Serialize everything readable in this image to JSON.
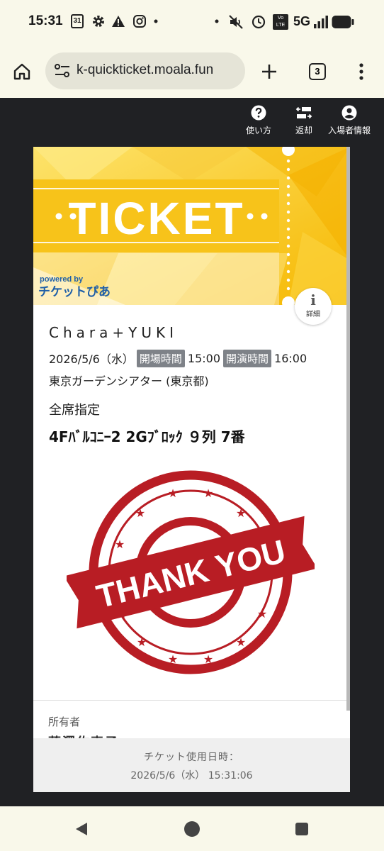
{
  "status_bar": {
    "time": "15:31",
    "calendar_day": "31",
    "network": "5G",
    "volte": "Vo LTE"
  },
  "browser": {
    "url": "k-quickticket.moala.fun",
    "tab_count": "3"
  },
  "nav": {
    "howto": "使い方",
    "return": "返却",
    "attendee": "入場者情報"
  },
  "ticket": {
    "banner_title": "TICKET",
    "powered_by": "powered by",
    "brand": "チケットぴあ",
    "info_label": "詳細",
    "artist": "Chara+YUKI",
    "date": "2026/5/6（水）",
    "open_label": "開場時間",
    "open_time": "15:00",
    "start_label": "開演時間",
    "start_time": "16:00",
    "venue": "東京ガーデンシアター (東京都)",
    "seat_type": "全席指定",
    "seat": "4Fﾊﾞﾙｺﾆｰ2 2Gﾌﾞﾛｯｸ ９列 7番",
    "stamp_text": "THANK YOU",
    "owner_label": "所有者",
    "owner_name": "蓮澤佐恵子",
    "used_label": "チケット使用日時：",
    "used_time": "2026/5/6（水） 15:31:06"
  },
  "colors": {
    "banner_yellow": "#f9c80e",
    "stamp_red": "#b81d24",
    "tag_gray": "#7e8288",
    "page_bg": "#202124",
    "chrome_bg": "#f9f8ea"
  }
}
